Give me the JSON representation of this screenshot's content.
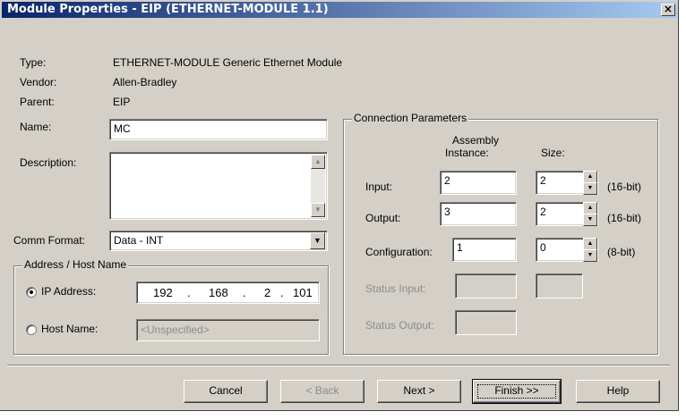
{
  "window": {
    "title": "Module Properties - EIP (ETHERNET-MODULE 1.1)",
    "close_glyph": "×"
  },
  "info": {
    "type_label": "Type:",
    "type_value": "ETHERNET-MODULE Generic Ethernet Module",
    "vendor_label": "Vendor:",
    "vendor_value": "Allen-Bradley",
    "parent_label": "Parent:",
    "parent_value": "EIP"
  },
  "form": {
    "name_label": "Name:",
    "name_value": "MC",
    "description_label": "Description:",
    "description_value": "",
    "comm_format_label": "Comm Format:",
    "comm_format_value": "Data - INT"
  },
  "address": {
    "group_title": "Address / Host Name",
    "ip_label": "IP Address:",
    "ip_octets": [
      "192",
      "168",
      "2",
      "101"
    ],
    "ip_dot": ".",
    "host_label": "Host Name:",
    "host_placeholder": "<Unspecified>",
    "ip_selected": true
  },
  "connection": {
    "group_title": "Connection Parameters",
    "col_assembly_line1": "Assembly",
    "col_assembly_line2": "Instance:",
    "col_size": "Size:",
    "rows": [
      {
        "label": "Input:",
        "instance": "2",
        "size": "2",
        "unit": "(16-bit)"
      },
      {
        "label": "Output:",
        "instance": "3",
        "size": "2",
        "unit": "(16-bit)"
      },
      {
        "label": "Configuration:",
        "instance": "1",
        "size": "0",
        "unit": "(8-bit)"
      }
    ],
    "status_input_label": "Status Input:",
    "status_output_label": "Status Output:"
  },
  "buttons": {
    "cancel": "Cancel",
    "back": "< Back",
    "next": "Next >",
    "finish": "Finish >>",
    "help": "Help"
  }
}
